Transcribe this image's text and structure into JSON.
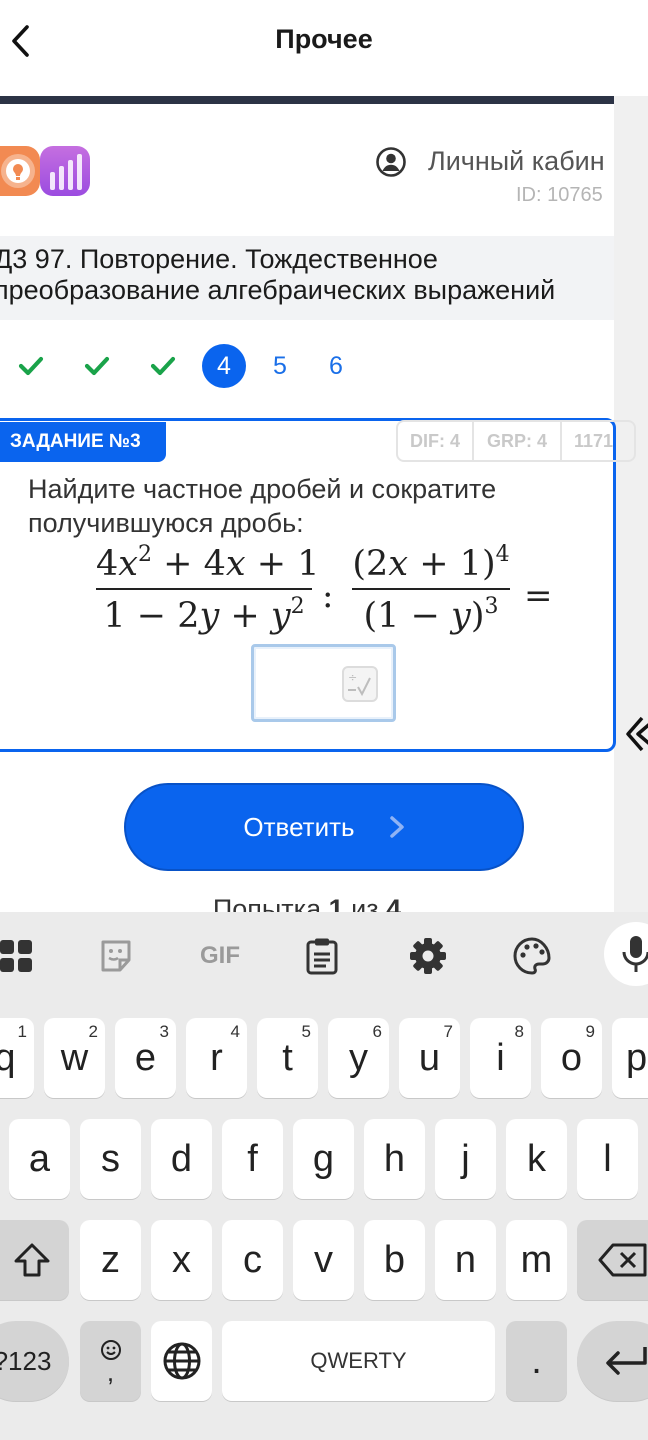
{
  "appbar": {
    "title": "Прочее"
  },
  "header": {
    "account_label": "Личный кабин",
    "account_id": "ID: 10765"
  },
  "lesson": {
    "title_line1": "Д3 97. Повторение. Тождественное",
    "title_line2": "преобразование алгебраических выражений"
  },
  "steps": {
    "labels": [
      "4",
      "5",
      "6"
    ]
  },
  "task": {
    "tag": "ЗАДАНИЕ №3",
    "dif": "DIF: 4",
    "grp": "GRP: 4",
    "num": "1171",
    "text": "Найдите частное дробей и сократите получившуюся дробь:"
  },
  "submit": {
    "label": "Ответить"
  },
  "attempts": {
    "prefix": "Попытка ",
    "current": "1",
    "middle": " из ",
    "total": "4"
  },
  "keyboard": {
    "row1": [
      {
        "k": "q",
        "h": "1"
      },
      {
        "k": "w",
        "h": "2"
      },
      {
        "k": "e",
        "h": "3"
      },
      {
        "k": "r",
        "h": "4"
      },
      {
        "k": "t",
        "h": "5"
      },
      {
        "k": "y",
        "h": "6"
      },
      {
        "k": "u",
        "h": "7"
      },
      {
        "k": "i",
        "h": "8"
      },
      {
        "k": "o",
        "h": "9"
      },
      {
        "k": "p",
        "h": ""
      }
    ],
    "row2": [
      "a",
      "s",
      "d",
      "f",
      "g",
      "h",
      "j",
      "k",
      "l"
    ],
    "row3": [
      "z",
      "x",
      "c",
      "v",
      "b",
      "n",
      "m"
    ],
    "toolbar_gif": "GIF",
    "numbers_label": "?123",
    "emoji_comma": ",",
    "space_label": "QWERTY",
    "period_label": "."
  },
  "colors": {
    "accent": "#0a64ee",
    "success": "#1aa34a",
    "keyboard_bg": "#ebebeb"
  }
}
